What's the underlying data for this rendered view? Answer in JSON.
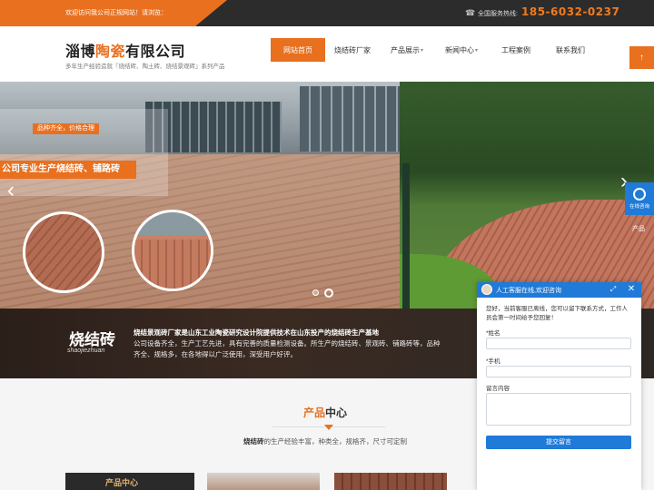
{
  "topbar": {
    "welcome": "欢迎访问我公司正规网站！请浏览：",
    "hotline_label": "全国服务热线:",
    "hotline_number": "185-6032-0237"
  },
  "header": {
    "title_part1": "淄博",
    "title_highlight": "陶瓷",
    "title_part2": "有限公司",
    "subtitle": "多年生产经验造就『烧结砖、陶土砖、烧结景观砖』系列产品"
  },
  "nav": {
    "items": [
      {
        "label": "网站首页"
      },
      {
        "label": "烧结砖厂家"
      },
      {
        "label": "产品展示"
      },
      {
        "label": "新闻中心"
      },
      {
        "label": "工程案例"
      },
      {
        "label": "联系我们"
      }
    ]
  },
  "fixed_top": {
    "label": "↑"
  },
  "banner": {
    "slogan_small": "品种齐全，价格合理",
    "slogan_big": "公司专业生产烧结砖、铺路砖",
    "slide_count": 2,
    "active_slide": 2
  },
  "consult": {
    "label": "在线咨询",
    "peek": "产品"
  },
  "intro": {
    "title": "烧结砖",
    "pinyin": "shaojiezhuan",
    "head": "烧结景观砖厂家是山东工业陶瓷研究设计院提供技术在山东投产的烧结砖生产基地",
    "body": "公司设备齐全，生产工艺先进，具有完善的质量检测设备。所生产的烧结砖、景观砖、铺路砖等，品种齐全、规格多，在各地得以广泛使用，深受用户好评。"
  },
  "product": {
    "title_highlight": "产品",
    "title_rest": "中心",
    "desc_bold": "烧结砖",
    "desc_rest": "的生产经验丰富，种类全，规格齐，尺寸可定制",
    "thumb1_label": "产品中心"
  },
  "chat": {
    "header_title": "人工客服在线,欢迎咨询",
    "message": "您好，当前客服已离线，您可以留下联系方式，工作人员会第一时间给予您回复！",
    "name_label": "*姓名",
    "phone_label": "*手机",
    "comment_label": "留言内容",
    "submit_label": "提交留言"
  },
  "colors": {
    "accent": "#e8701f",
    "chat_blue": "#1f7ad8",
    "topbar_bg": "#2c2c2c"
  }
}
